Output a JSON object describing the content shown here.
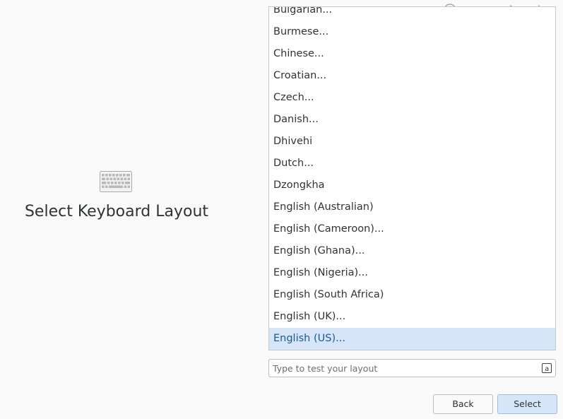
{
  "page": {
    "title": "Select Keyboard Layout"
  },
  "status_icons": [
    {
      "name": "accessibility-icon"
    },
    {
      "name": "network-disconnected-icon"
    },
    {
      "name": "bluetooth-icon"
    },
    {
      "name": "power-icon"
    }
  ],
  "layouts": {
    "items": [
      "Bulgarian...",
      "Burmese...",
      "Chinese...",
      "Croatian...",
      "Czech...",
      "Danish...",
      "Dhivehi",
      "Dutch...",
      "Dzongkha",
      "English (Australian)",
      "English (Cameroon)...",
      "English (Ghana)...",
      "English (Nigeria)...",
      "English (South Africa)",
      "English (UK)...",
      "English (US)..."
    ],
    "selected": "English (US)..."
  },
  "test_field": {
    "placeholder": "Type to test your layout",
    "value": ""
  },
  "buttons": {
    "back_label": "Back",
    "select_label": "Select"
  },
  "colors": {
    "accent": "#d6e6f8",
    "selected_text": "#1a5a9c"
  }
}
